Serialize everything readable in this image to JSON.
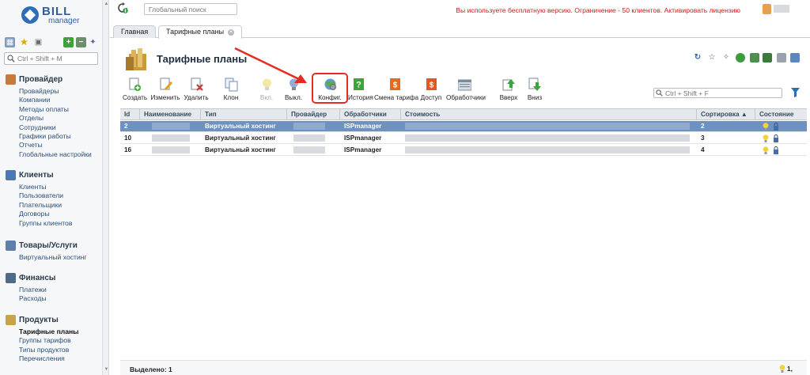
{
  "brand": {
    "word": "BILL",
    "sub": "manager"
  },
  "sidebar": {
    "search_placeholder": "Ctrl + Shift + M",
    "groups": [
      {
        "title": "Провайдер",
        "items": [
          "Провайдеры",
          "Компании",
          "Методы оплаты",
          "Отделы",
          "Сотрудники",
          "Графики работы",
          "Отчеты",
          "Глобальные настройки"
        ]
      },
      {
        "title": "Клиенты",
        "items": [
          "Клиенты",
          "Пользователи",
          "Плательщики",
          "Договоры",
          "Группы клиентов"
        ]
      },
      {
        "title": "Товары/Услуги",
        "items": [
          "Виртуальный хостинг"
        ]
      },
      {
        "title": "Финансы",
        "items": [
          "Платежи",
          "Расходы"
        ]
      },
      {
        "title": "Продукты",
        "items": [
          "Тарифные планы",
          "Группы тарифов",
          "Типы продуктов",
          "Перечисления"
        ],
        "active_index": 0
      }
    ]
  },
  "topbar": {
    "search_placeholder": "Глобальный поиск",
    "warning": "Вы используете бесплатную версию. Ограничение - 50 клиентов. Активировать лицензию"
  },
  "tabs": [
    {
      "label": "Главная",
      "active": false
    },
    {
      "label": "Тарифные планы",
      "active": true
    }
  ],
  "page": {
    "title": "Тарифные планы"
  },
  "toolbar": [
    {
      "label": "Создать",
      "icon": "create-icon",
      "enabled": true
    },
    {
      "label": "Изменить",
      "icon": "edit-icon",
      "enabled": true
    },
    {
      "label": "Удалить",
      "icon": "delete-icon",
      "enabled": true
    },
    {
      "label": "Клон",
      "icon": "clone-icon",
      "enabled": true
    },
    {
      "label": "Вкл.",
      "icon": "bulb-on-icon",
      "enabled": false
    },
    {
      "label": "Выкл.",
      "icon": "bulb-off-icon",
      "enabled": true
    },
    {
      "label": "Конфиг.",
      "icon": "config-icon",
      "enabled": true
    },
    {
      "label": "История",
      "icon": "history-icon",
      "enabled": true
    },
    {
      "label": "Смена тарифа",
      "icon": "change-tariff-icon",
      "enabled": true
    },
    {
      "label": "Доступ",
      "icon": "access-icon",
      "enabled": true
    },
    {
      "label": "Обработчики",
      "icon": "handlers-icon",
      "enabled": true
    },
    {
      "label": "Вверх",
      "icon": "arrow-up-icon",
      "enabled": true
    },
    {
      "label": "Вниз",
      "icon": "arrow-down-icon",
      "enabled": true
    }
  ],
  "filter": {
    "placeholder": "Ctrl + Shift + F"
  },
  "table": {
    "columns": [
      "Id",
      "Наименование",
      "Тип",
      "Провайдер",
      "Обработчики",
      "Стоимость",
      "Сортировка ▲",
      "Состояние"
    ],
    "rows": [
      {
        "id": "2",
        "name": "",
        "type": "Виртуальный хостинг",
        "provider": "",
        "handler": "ISPmanager",
        "cost": "",
        "sort": "2",
        "selected": true
      },
      {
        "id": "10",
        "name": "",
        "type": "Виртуальный хостинг",
        "provider": "",
        "handler": "ISPmanager",
        "cost": "",
        "sort": "3",
        "selected": false
      },
      {
        "id": "16",
        "name": "",
        "type": "Виртуальный хостинг",
        "provider": "",
        "handler": "ISPmanager",
        "cost": "",
        "sort": "4",
        "selected": false
      }
    ]
  },
  "status": {
    "selected": "Выделено: 1",
    "active_count": "1,"
  },
  "colors": {
    "accent": "#2f6db5",
    "selected_row": "#6f91bd",
    "warning": "#d8151b",
    "highlight": "#e52b24"
  }
}
